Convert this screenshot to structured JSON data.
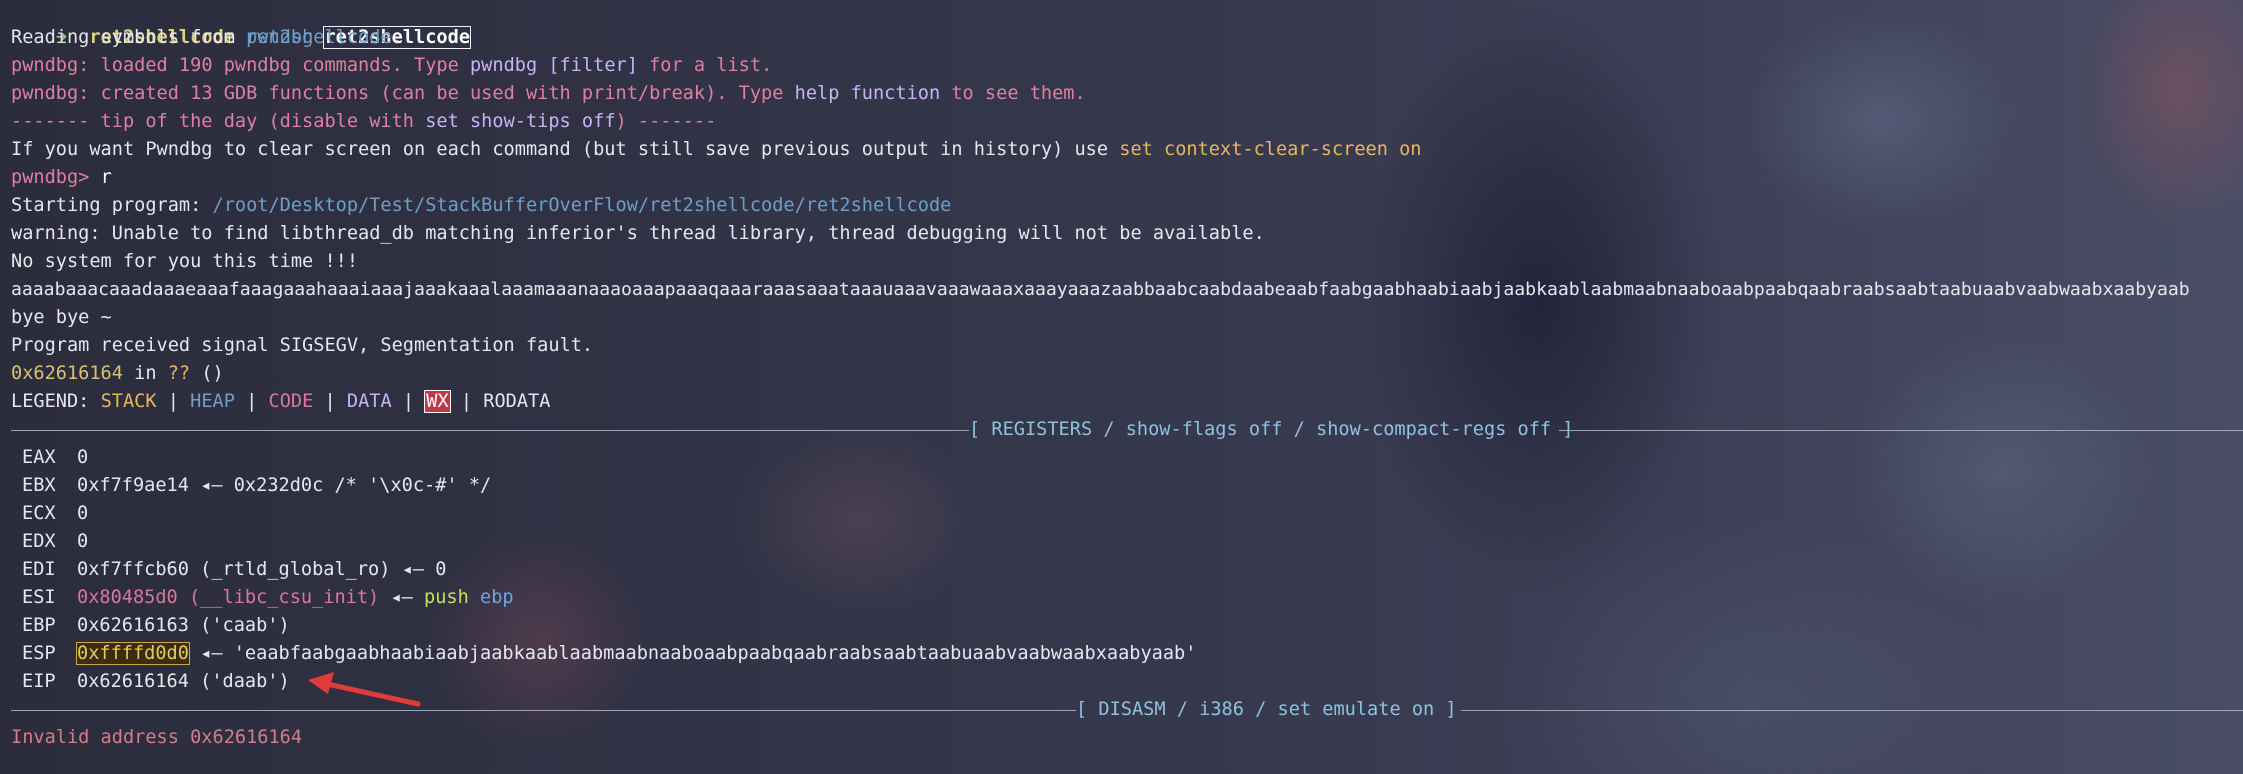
{
  "prompt": {
    "arrow": "➜",
    "dir": "ret2shellcode",
    "cmd": "pwndbg",
    "arg": "ret2shellcode"
  },
  "lines": {
    "reading_prefix": "Reading symbols from ",
    "reading_file": "ret2shellcode",
    "reading_suffix": "...",
    "loaded_tag": "pwndbg:",
    "loaded_text_a": " loaded 190 pwndbg commands. Type ",
    "loaded_cmd": "pwndbg [filter]",
    "loaded_text_b": " for a list.",
    "created_tag": "pwndbg:",
    "created_text_a": " created 13 GDB functions (can be used with print/break). Type ",
    "created_help": "help function",
    "created_text_b": " to see them.",
    "tip_a": "------- tip of the day (disable with ",
    "tip_cmd": "set show-tips off",
    "tip_b": ") -------",
    "tip_body": "If you want Pwndbg to clear screen on each command (but still save previous output in history) use ",
    "tip_body_cmd": "set context-clear-screen on",
    "prompt2": "pwndbg>",
    "prompt2_cmd": " r",
    "starting_prefix": "Starting program: ",
    "starting_path": "/root/Desktop/Test/StackBufferOverFlow/ret2shellcode/ret2shellcode",
    "warning": "warning: Unable to find libthread_db matching inferior's thread library, thread debugging will not be available.",
    "no_system": "No system for you this time !!!",
    "pattern": "aaaabaaacaaadaaaeaaafaaagaaahaaaiaaajaaakaaalaaamaaanaaaoaaapaaaqaaaraaasaaataaauaaavaaawaaaxaaayaaazaabbaabcaabdaabeaabfaabgaabhaabiaabjaabkaablaabmaabnaaboaabpaabqaabraabsaabtaabuaabvaabwaabxaabyaab",
    "bye": "bye bye ~",
    "sigsegv": "Program received signal SIGSEGV, Segmentation fault.",
    "fault_addr": "0x62616164",
    "fault_in": " in ",
    "fault_q": "??",
    "fault_paren": " ()",
    "legend_label": "LEGEND: ",
    "legend_stack": "STACK",
    "legend_heap": "HEAP",
    "legend_code": "CODE",
    "legend_data": "DATA",
    "legend_wx": "WX",
    "legend_rodata": "RODATA",
    "legend_bar": " | "
  },
  "registers_header": "[ REGISTERS / show-flags off / show-compact-regs off ]",
  "registers": {
    "eax": {
      "name": "EAX",
      "value": "0"
    },
    "ebx": {
      "name": "EBX",
      "value": "0xf7f9ae14",
      "deref": " ◂— 0x232d0c /* '\\x0c-#' */"
    },
    "ecx": {
      "name": "ECX",
      "value": "0"
    },
    "edx": {
      "name": "EDX",
      "value": "0"
    },
    "edi": {
      "name": "EDI",
      "value": "0xf7ffcb60 (_rtld_global_ro)",
      "deref": " ◂— 0"
    },
    "esi": {
      "name": "ESI",
      "value": "0x80485d0 (__libc_csu_init)",
      "arrow": " ◂— ",
      "insn": "push",
      "operand": "ebp"
    },
    "ebp": {
      "name": "EBP",
      "value": "0x62616163 ('caab')"
    },
    "esp": {
      "name": "ESP",
      "value": "0xffffd0d0",
      "deref": " ◂— 'eaabfaabgaabhaabiaabjaabkaablaabmaabnaaboaabpaabqaabraabsaabtaabuaabvaabwaabxaabyaab'"
    },
    "eip": {
      "name": "EIP",
      "value": "0x62616164 ('daab')"
    }
  },
  "disasm_header": "[ DISASM / i386 / set emulate on ]",
  "disasm_error": "Invalid address 0x62616164",
  "colors": {
    "background": "#2d2e40",
    "prompt_green": "#7fd06a",
    "pwndbg_pink": "#e17fa3",
    "separator_cyan": "#8fc2df",
    "annotation_arrow": "#e23b3b"
  }
}
